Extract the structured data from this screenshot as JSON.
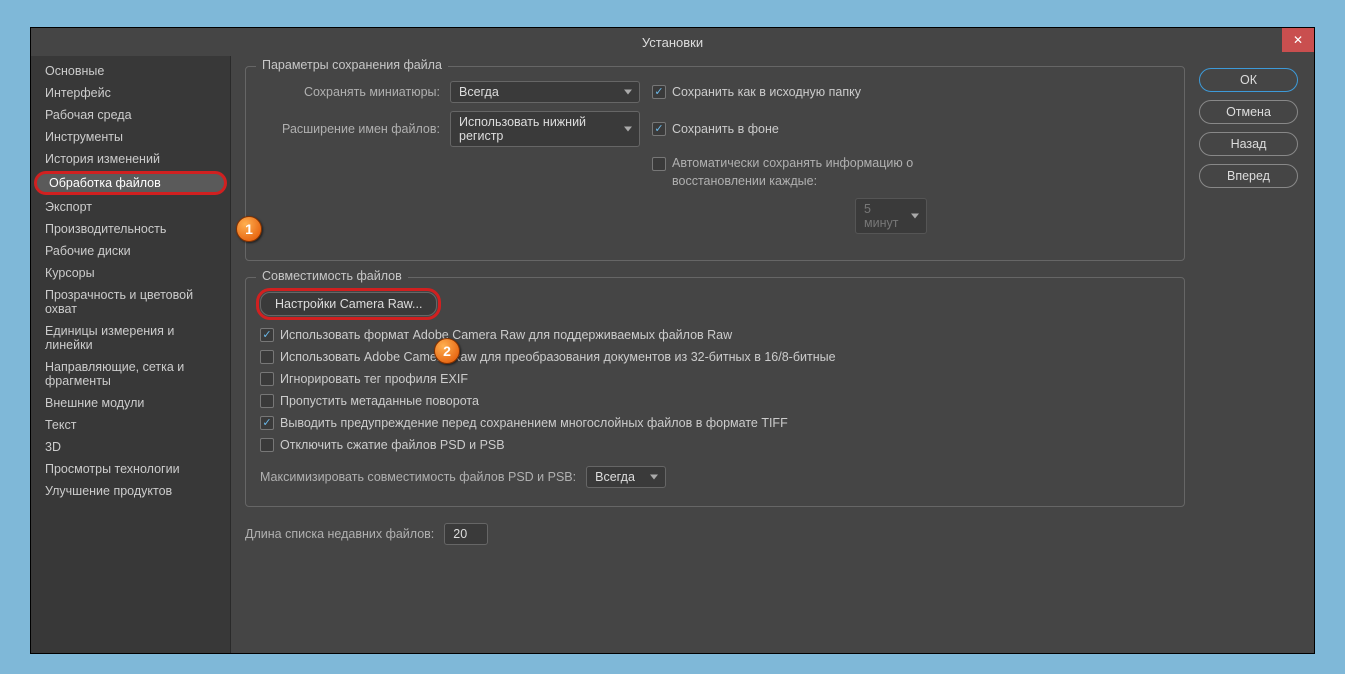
{
  "window": {
    "title": "Установки"
  },
  "sidebar": {
    "items": [
      {
        "label": "Основные"
      },
      {
        "label": "Интерфейс"
      },
      {
        "label": "Рабочая среда"
      },
      {
        "label": "Инструменты"
      },
      {
        "label": "История изменений"
      },
      {
        "label": "Обработка файлов",
        "active": true,
        "badge": "1"
      },
      {
        "label": "Экспорт"
      },
      {
        "label": "Производительность"
      },
      {
        "label": "Рабочие диски"
      },
      {
        "label": "Курсоры"
      },
      {
        "label": "Прозрачность и цветовой охват"
      },
      {
        "label": "Единицы измерения и линейки"
      },
      {
        "label": "Направляющие, сетка и фрагменты"
      },
      {
        "label": "Внешние модули"
      },
      {
        "label": "Текст"
      },
      {
        "label": "3D"
      },
      {
        "label": "Просмотры технологии"
      },
      {
        "label": "Улучшение продуктов"
      }
    ]
  },
  "actions": {
    "ok": "ОК",
    "cancel": "Отмена",
    "back": "Назад",
    "forward": "Вперед"
  },
  "fileSave": {
    "legend": "Параметры сохранения файла",
    "thumbLabel": "Сохранять миниатюры:",
    "thumbValue": "Всегда",
    "extLabel": "Расширение имен файлов:",
    "extValue": "Использовать нижний регистр",
    "saveOriginal": "Сохранить как в исходную папку",
    "saveBackground": "Сохранить в фоне",
    "autoRecover": "Автоматически сохранять информацию о восстановлении каждые:",
    "autoRecoverInterval": "5 минут"
  },
  "compat": {
    "legend": "Совместимость файлов",
    "cameraRawBtn": "Настройки Camera Raw...",
    "cameraRawBadge": "2",
    "useAdobeRaw": "Использовать формат Adobe Camera Raw для поддерживаемых файлов Raw",
    "useAdobeRaw32": "Использовать Adobe Camera Raw для преобразования документов из 32-битных в 16/8-битные",
    "ignoreExif": "Игнорировать тег профиля EXIF",
    "skipRotation": "Пропустить метаданные поворота",
    "tiffWarn": "Выводить предупреждение перед сохранением многослойных файлов в формате TIFF",
    "disablePsdComp": "Отключить сжатие файлов PSD и PSB",
    "maxCompatLabel": "Максимизировать совместимость файлов PSD и PSB:",
    "maxCompatValue": "Всегда"
  },
  "recent": {
    "label": "Длина списка недавних файлов:",
    "value": "20"
  }
}
